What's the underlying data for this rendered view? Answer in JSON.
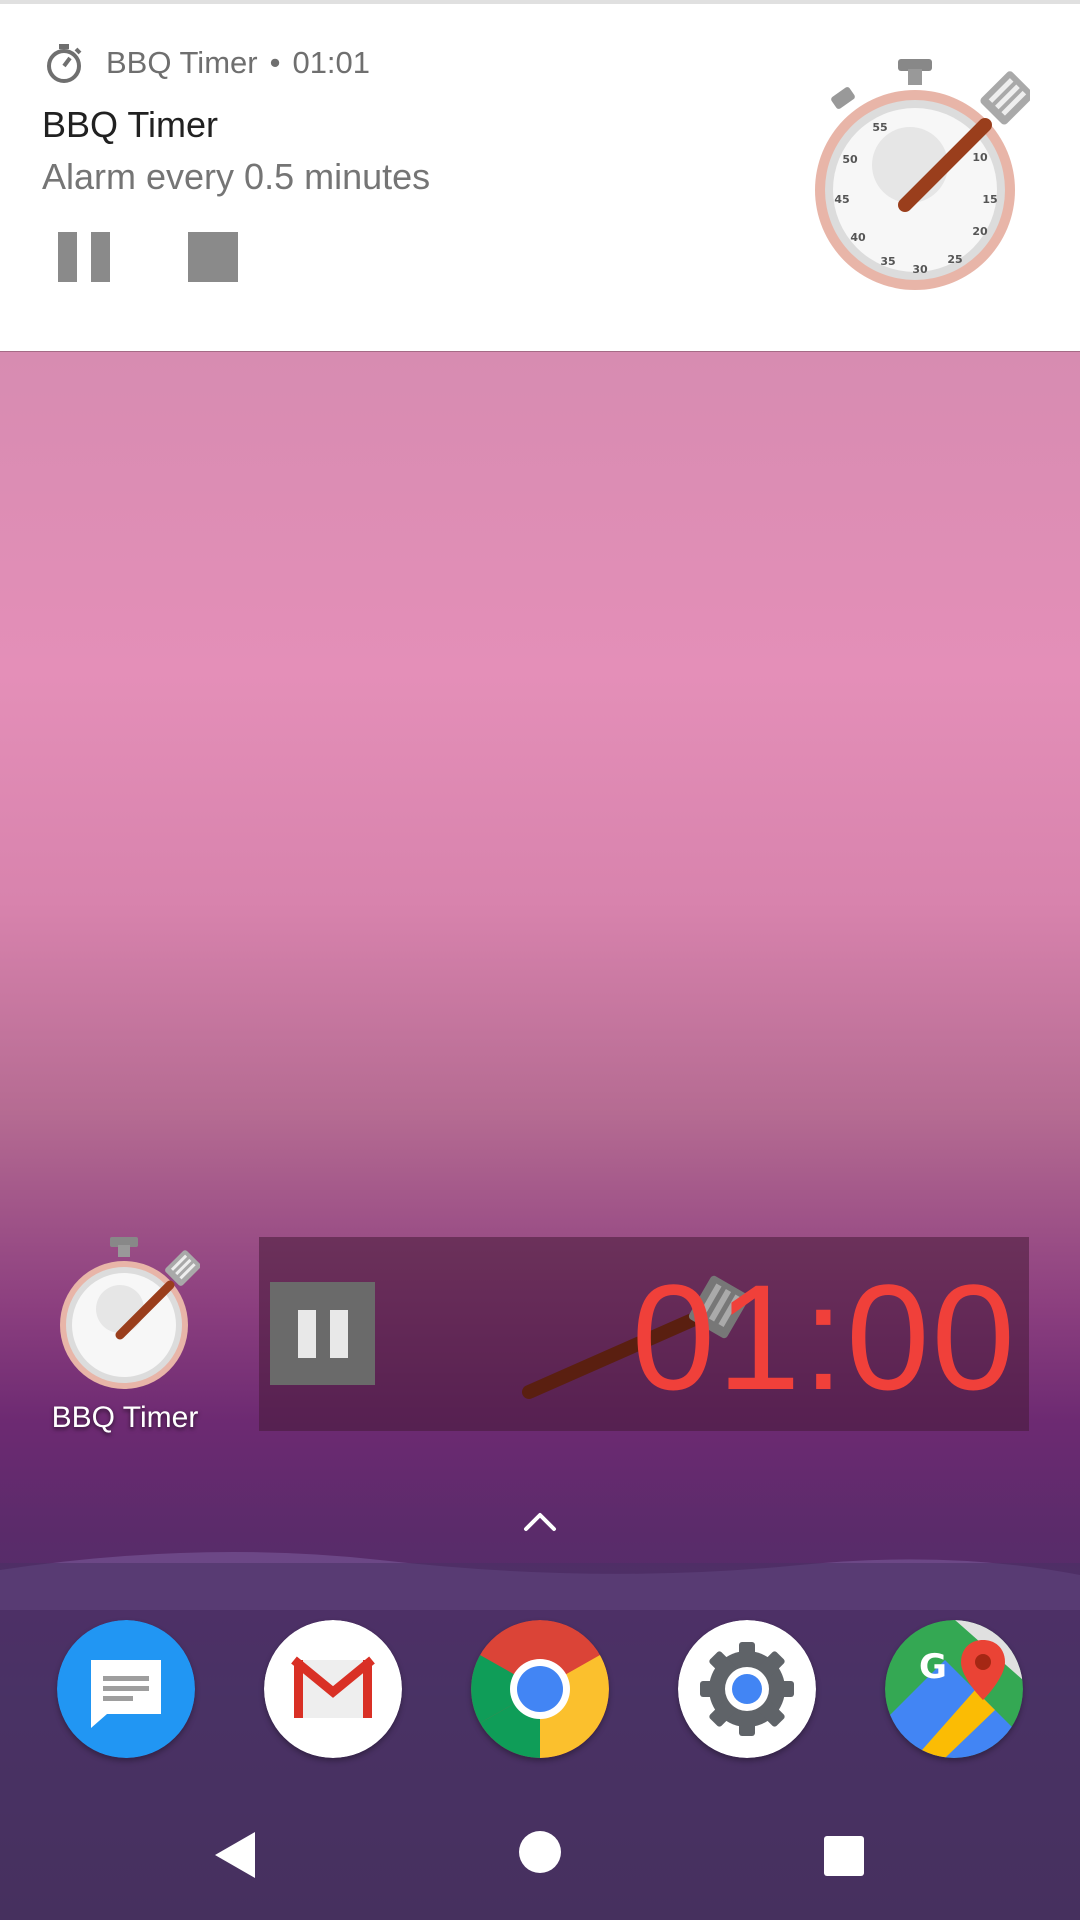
{
  "notification": {
    "app_name": "BBQ Timer",
    "separator": "•",
    "time": "01:01",
    "title": "BBQ Timer",
    "text": "Alarm every 0.5 minutes",
    "actions": [
      "pause",
      "stop"
    ]
  },
  "home": {
    "app_label": "BBQ Timer",
    "widget_time": "01:00"
  },
  "dock": {
    "apps": [
      "messages-icon",
      "gmail-icon",
      "chrome-icon",
      "settings-icon",
      "maps-icon"
    ]
  },
  "colors": {
    "timer_red": "#f0403a",
    "notification_bg": "#ffffff"
  }
}
